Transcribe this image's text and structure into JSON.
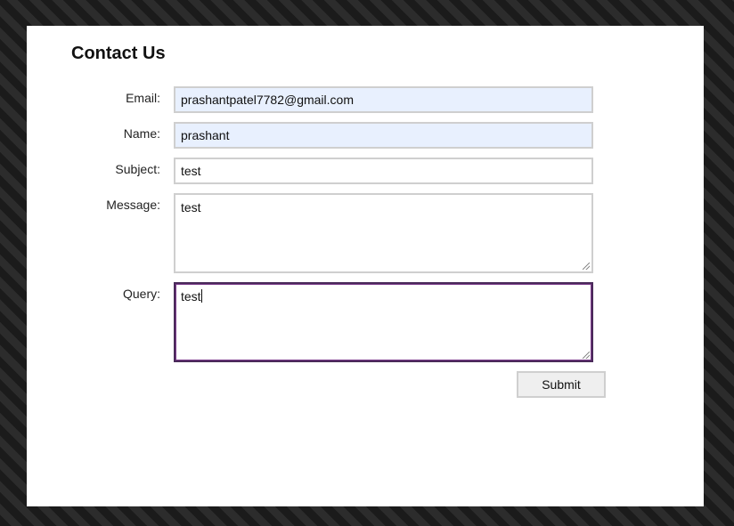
{
  "form": {
    "title": "Contact Us",
    "fields": {
      "email": {
        "label": "Email:",
        "value": "prashantpatel7782@gmail.com"
      },
      "name": {
        "label": "Name:",
        "value": "prashant"
      },
      "subject": {
        "label": "Subject:",
        "value": "test"
      },
      "message": {
        "label": "Message:",
        "value": "test"
      },
      "query": {
        "label": "Query:",
        "value": "test"
      }
    },
    "submit_label": "Submit"
  },
  "colors": {
    "autofill_background": "#e8f0fe",
    "focus_border": "#4a2a5a",
    "button_background": "#efefef"
  }
}
